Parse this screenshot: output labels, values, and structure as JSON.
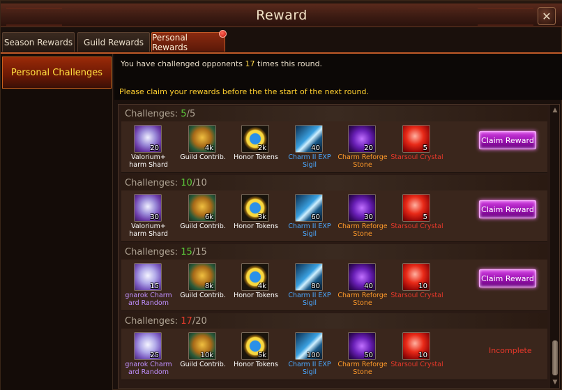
{
  "window": {
    "title": "Reward",
    "close_glyph": "✕"
  },
  "tabs": [
    {
      "label": "Season Rewards",
      "active": false
    },
    {
      "label": "Guild Rewards",
      "active": false
    },
    {
      "label": "Personal Rewards",
      "active": true,
      "badge": true
    }
  ],
  "sidebar": {
    "items": [
      {
        "label": "Personal Challenges",
        "active": true
      }
    ]
  },
  "info": {
    "line1_prefix": "You have challenged opponents ",
    "line1_count": "17",
    "line1_suffix": " times this round.",
    "line2": "Please claim your rewards before the the start of the next round."
  },
  "colors": {
    "accent": "#c05a28",
    "highlight": "#ffd030",
    "complete": "#5ccc3a",
    "incomplete": "#e8382a",
    "claim": "#b020c8"
  },
  "challenges": [
    {
      "label": "Challenges: ",
      "current": "5",
      "total": "/5",
      "complete": true,
      "items": [
        {
          "icon": "valorium-charm-shard-chest-icon",
          "qty": "20",
          "name": "Valorium+\nharm Shard",
          "color": "white"
        },
        {
          "icon": "guild-contrib-icon",
          "qty": "4k",
          "name": "Guild Contrib.",
          "color": "white"
        },
        {
          "icon": "honor-tokens-icon",
          "qty": "2k",
          "name": "Honor Tokens",
          "color": "white"
        },
        {
          "icon": "charm-exp-sigil-icon",
          "qty": "40",
          "name": "Charm II EXP\nSigil",
          "color": "blue"
        },
        {
          "icon": "charm-reforge-stone-icon",
          "qty": "20",
          "name": "Charm Reforge\nStone",
          "color": "orange"
        },
        {
          "icon": "starsoul-crystal-icon",
          "qty": "5",
          "name": "Starsoul Crystal",
          "color": "red"
        }
      ],
      "action": "Claim Reward"
    },
    {
      "label": "Challenges: ",
      "current": "10",
      "total": "/10",
      "complete": true,
      "items": [
        {
          "icon": "valorium-charm-shard-chest-icon",
          "qty": "30",
          "name": "Valorium+\nharm Shard",
          "color": "white"
        },
        {
          "icon": "guild-contrib-icon",
          "qty": "6k",
          "name": "Guild Contrib.",
          "color": "white"
        },
        {
          "icon": "honor-tokens-icon",
          "qty": "3k",
          "name": "Honor Tokens",
          "color": "white"
        },
        {
          "icon": "charm-exp-sigil-icon",
          "qty": "60",
          "name": "Charm II EXP\nSigil",
          "color": "blue"
        },
        {
          "icon": "charm-reforge-stone-icon",
          "qty": "30",
          "name": "Charm Reforge\nStone",
          "color": "orange"
        },
        {
          "icon": "starsoul-crystal-icon",
          "qty": "5",
          "name": "Starsoul Crystal",
          "color": "red"
        }
      ],
      "action": "Claim Reward"
    },
    {
      "label": "Challenges: ",
      "current": "15",
      "total": "/15",
      "complete": true,
      "items": [
        {
          "icon": "ragnarok-charm-shard-chest-icon",
          "qty": "15",
          "name": "gnarok Charm\nard Random",
          "color": "purple"
        },
        {
          "icon": "guild-contrib-icon",
          "qty": "8k",
          "name": "Guild Contrib.",
          "color": "white"
        },
        {
          "icon": "honor-tokens-icon",
          "qty": "4k",
          "name": "Honor Tokens",
          "color": "white"
        },
        {
          "icon": "charm-exp-sigil-icon",
          "qty": "80",
          "name": "Charm II EXP\nSigil",
          "color": "blue"
        },
        {
          "icon": "charm-reforge-stone-icon",
          "qty": "40",
          "name": "Charm Reforge\nStone",
          "color": "orange"
        },
        {
          "icon": "starsoul-crystal-icon",
          "qty": "10",
          "name": "Starsoul Crystal",
          "color": "red"
        }
      ],
      "action": "Claim Reward"
    },
    {
      "label": "Challenges: ",
      "current": "17",
      "total": "/20",
      "complete": false,
      "items": [
        {
          "icon": "ragnarok-charm-shard-chest-icon",
          "qty": "25",
          "name": "gnarok Charm\nard Random",
          "color": "purple"
        },
        {
          "icon": "guild-contrib-icon",
          "qty": "10k",
          "name": "Guild Contrib.",
          "color": "white"
        },
        {
          "icon": "honor-tokens-icon",
          "qty": "5k",
          "name": "Honor Tokens",
          "color": "white"
        },
        {
          "icon": "charm-exp-sigil-icon",
          "qty": "100",
          "name": "Charm II EXP\nSigil",
          "color": "blue"
        },
        {
          "icon": "charm-reforge-stone-icon",
          "qty": "50",
          "name": "Charm Reforge\nStone",
          "color": "orange"
        },
        {
          "icon": "starsoul-crystal-icon",
          "qty": "10",
          "name": "Starsoul Crystal",
          "color": "red"
        }
      ],
      "status": "Incomplete"
    }
  ],
  "scrollbar": {
    "up": "▲",
    "down": "▼"
  }
}
